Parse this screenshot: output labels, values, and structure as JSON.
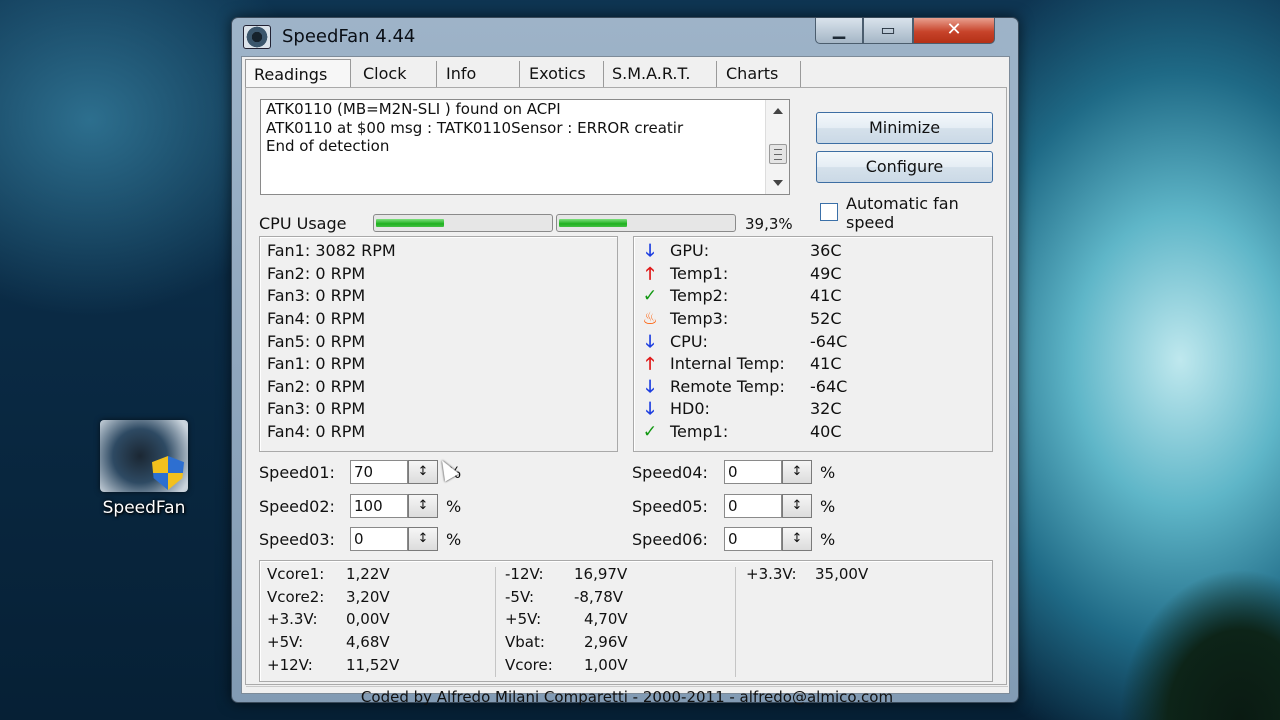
{
  "desktop": {
    "icon_label": "SpeedFan"
  },
  "window": {
    "title": "SpeedFan 4.44",
    "caption_buttons": {
      "minimize": "▁",
      "maximize": "▭",
      "close": "✕"
    }
  },
  "tabs": [
    "Readings",
    "Clock",
    "Info",
    "Exotics",
    "S.M.A.R.T.",
    "Charts"
  ],
  "log_lines": [
    "ATK0110 (MB=M2N-SLI ) found on ACPI",
    "ATK0110 at $00 msg : TATK0110Sensor : ERROR creatir",
    "End of detection"
  ],
  "buttons": {
    "minimize": "Minimize",
    "configure": "Configure"
  },
  "auto_fan": {
    "label": "Automatic fan speed",
    "checked": false
  },
  "cpu_usage": {
    "label": "CPU Usage",
    "core1_fill": 0.39,
    "core2_fill": 0.39,
    "percent_text": "39,3%"
  },
  "fans": [
    "Fan1: 3082 RPM",
    "Fan2: 0 RPM",
    "Fan3: 0 RPM",
    "Fan4: 0 RPM",
    "Fan5: 0 RPM",
    "Fan1: 0 RPM",
    "Fan2: 0 RPM",
    "Fan3: 0 RPM",
    "Fan4: 0 RPM"
  ],
  "temps": [
    {
      "icon": "arrow-down-icon",
      "name": "GPU:",
      "value": "36C"
    },
    {
      "icon": "arrow-up-icon",
      "name": "Temp1:",
      "value": "49C"
    },
    {
      "icon": "check-icon",
      "name": "Temp2:",
      "value": "41C"
    },
    {
      "icon": "flame-icon",
      "name": "Temp3:",
      "value": "52C"
    },
    {
      "icon": "arrow-down-icon",
      "name": "CPU:",
      "value": "-64C"
    },
    {
      "icon": "arrow-up-icon",
      "name": "Internal Temp:",
      "value": "41C"
    },
    {
      "icon": "arrow-down-icon",
      "name": "Remote Temp:",
      "value": "-64C"
    },
    {
      "icon": "arrow-down-icon",
      "name": "HD0:",
      "value": "32C"
    },
    {
      "icon": "check-icon",
      "name": "Temp1:",
      "value": "40C"
    }
  ],
  "speeds": [
    {
      "label": "Speed01:",
      "value": "70"
    },
    {
      "label": "Speed02:",
      "value": "100"
    },
    {
      "label": "Speed03:",
      "value": "0"
    },
    {
      "label": "Speed04:",
      "value": "0"
    },
    {
      "label": "Speed05:",
      "value": "0"
    },
    {
      "label": "Speed06:",
      "value": "0"
    }
  ],
  "speed_unit": "%",
  "spin_glyph": "↕",
  "voltages": {
    "col1": [
      {
        "name": "Vcore1:",
        "value": "1,22V"
      },
      {
        "name": "Vcore2:",
        "value": "3,20V"
      },
      {
        "name": "+3.3V:",
        "value": "0,00V"
      },
      {
        "name": "+5V:",
        "value": "4,68V"
      },
      {
        "name": "+12V:",
        "value": "11,52V"
      }
    ],
    "col2": [
      {
        "name": "-12V:",
        "value": "16,97V"
      },
      {
        "name": "-5V:",
        "value": "-8,78V"
      },
      {
        "name": "+5V:",
        "value": "4,70V"
      },
      {
        "name": "Vbat:",
        "value": "2,96V"
      },
      {
        "name": "Vcore:",
        "value": "1,00V"
      }
    ],
    "col3": [
      {
        "name": "+3.3V:",
        "value": "35,00V"
      }
    ]
  },
  "status_bar": "Coded by Alfredo Milani Comparetti - 2000-2011 - alfredo@almico.com",
  "icon_glyphs": {
    "arrow-down-icon": "🡓",
    "arrow-up-icon": "🡑",
    "check-icon": "✓",
    "flame-icon": "♨"
  }
}
